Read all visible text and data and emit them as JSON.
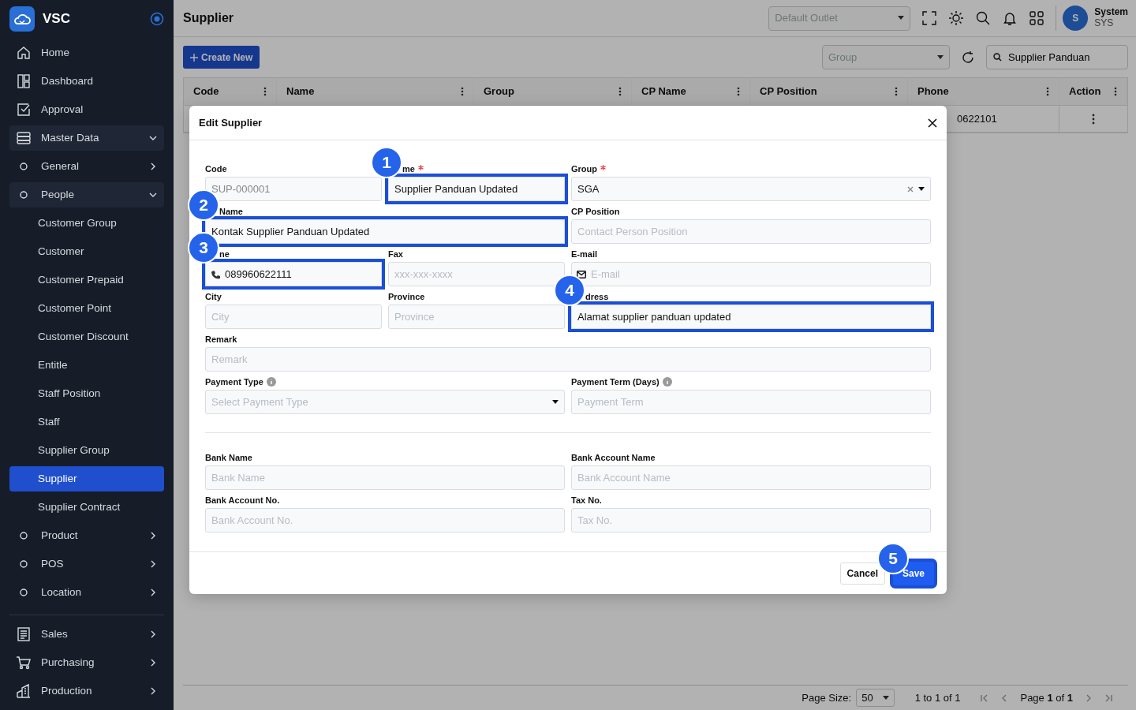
{
  "sidebar": {
    "logo": "VSC",
    "groups": [
      {
        "items": [
          {
            "label": "Home",
            "selected": false
          },
          {
            "label": "Dashboard",
            "selected": false
          },
          {
            "label": "Approval",
            "selected": false
          },
          {
            "label": "Master Data",
            "selected": false,
            "expanded": true,
            "children": [
              {
                "label": "General",
                "selected": false,
                "expanded": false
              },
              {
                "label": "People",
                "selected": false,
                "expanded": true,
                "children": [
                  {
                    "label": "Customer Group",
                    "selected": false
                  },
                  {
                    "label": "Customer",
                    "selected": false
                  },
                  {
                    "label": "Customer Prepaid",
                    "selected": false
                  },
                  {
                    "label": "Customer Point",
                    "selected": false
                  },
                  {
                    "label": "Customer Discount",
                    "selected": false
                  },
                  {
                    "label": "Entitle",
                    "selected": false
                  },
                  {
                    "label": "Staff Position",
                    "selected": false
                  },
                  {
                    "label": "Staff",
                    "selected": false
                  },
                  {
                    "label": "Supplier Group",
                    "selected": false
                  },
                  {
                    "label": "Supplier",
                    "selected": true
                  },
                  {
                    "label": "Supplier Contract",
                    "selected": false
                  }
                ]
              },
              {
                "label": "Product",
                "selected": false,
                "expanded": false
              },
              {
                "label": "POS",
                "selected": false,
                "expanded": false
              },
              {
                "label": "Location",
                "selected": false,
                "expanded": false
              }
            ]
          }
        ]
      },
      {
        "items": [
          {
            "label": "Sales",
            "selected": false,
            "expanded": false
          },
          {
            "label": "Purchasing",
            "selected": false,
            "expanded": false
          },
          {
            "label": "Production",
            "selected": false,
            "expanded": false
          }
        ]
      }
    ]
  },
  "header": {
    "title": "Supplier",
    "outlet": {
      "placeholder": "Default Outlet"
    },
    "user": {
      "initial": "S",
      "name": "System",
      "code": "SYS"
    }
  },
  "toolbar": {
    "create_button": "Create New",
    "group_filter": {
      "placeholder": "Group"
    },
    "search": {
      "value": "Supplier Panduan"
    }
  },
  "table": {
    "columns": [
      "Code",
      "Name",
      "Group",
      "CP Name",
      "CP Position",
      "Phone",
      "Action"
    ],
    "rows": [
      {
        "phone": "0622101"
      }
    ]
  },
  "pagination": {
    "page_size_label": "Page Size:",
    "page_size": "50",
    "range": "1 to 1 of 1",
    "page": "Page **1** of **1**"
  },
  "modal": {
    "title": "Edit Supplier",
    "fields": [
      {
        "label": "Code",
        "kind": "text",
        "value": "SUP-000001",
        "disabled": true
      },
      {
        "label": "me",
        "kind": "text",
        "required": true,
        "value": "Supplier Panduan Updated",
        "highlighted": true,
        "badge": "1"
      },
      {
        "label": "Group",
        "kind": "combo",
        "required": true,
        "value": "SGA"
      },
      {
        "label": "Name",
        "kind": "text",
        "value": "Kontak Supplier Panduan Updated",
        "highlighted": true,
        "badge": "2"
      },
      {
        "label": "CP Position",
        "kind": "text",
        "placeholder": "Contact Person Position"
      },
      {
        "label": "ne",
        "kind": "phone",
        "value": "089960622111",
        "highlighted": true,
        "badge": "3"
      },
      {
        "label": "Fax",
        "kind": "text",
        "placeholder": "xxx-xxx-xxxx"
      },
      {
        "label": "E-mail",
        "kind": "email",
        "placeholder": "E-mail"
      },
      {
        "label": "City",
        "kind": "text",
        "placeholder": "City"
      },
      {
        "label": "Province",
        "kind": "text",
        "placeholder": "Province"
      },
      {
        "label": "dress",
        "kind": "text",
        "value": "Alamat supplier panduan updated",
        "highlighted": true,
        "badge": "4"
      },
      {
        "label": "Remark",
        "kind": "text",
        "placeholder": "Remark"
      },
      {
        "label": "Payment Type",
        "kind": "select",
        "placeholder": "Select Payment Type",
        "info": true
      },
      {
        "label": "Payment Term (Days)",
        "kind": "text",
        "placeholder": "Payment Term",
        "info": true
      },
      {
        "kind": "divider"
      },
      {
        "label": "Bank Name",
        "kind": "text",
        "placeholder": "Bank Name"
      },
      {
        "label": "Bank Account Name",
        "kind": "text",
        "placeholder": "Bank Account Name"
      },
      {
        "label": "Bank Account No.",
        "kind": "text",
        "placeholder": "Bank Account No."
      },
      {
        "label": "Tax No.",
        "kind": "text",
        "placeholder": "Tax No."
      }
    ],
    "buttons": [
      {
        "label": "Cancel",
        "kind": "secondary"
      },
      {
        "label": "Save",
        "kind": "primary",
        "highlighted": true,
        "badge": "5"
      }
    ]
  }
}
